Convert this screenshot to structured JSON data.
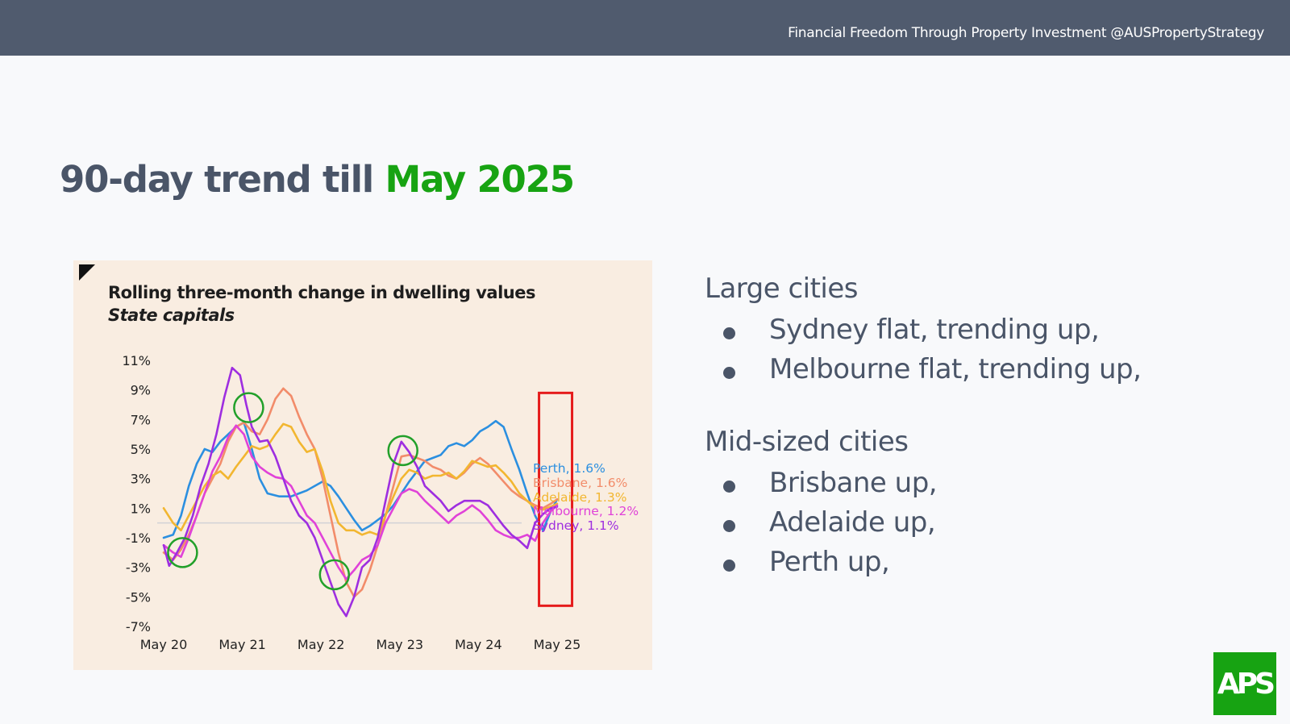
{
  "header": {
    "tagline": "Financial Freedom Through Property Investment @AUSPropertyStrategy"
  },
  "slide": {
    "title_prefix": "90-day trend till ",
    "title_accent": "May 2025"
  },
  "chart_data": {
    "type": "line",
    "title": "Rolling three-month change in dwelling values",
    "subtitle": "State capitals",
    "ylim": [
      -7,
      11
    ],
    "yticks": [
      11,
      9,
      7,
      5,
      3,
      1,
      -1,
      -3,
      -5,
      -7
    ],
    "ytick_labels": [
      "11%",
      "9%",
      "7%",
      "5%",
      "3%",
      "1%",
      "-1%",
      "-3%",
      "-5%",
      "-7%"
    ],
    "xlim": [
      2020.33,
      2025.42
    ],
    "xticks": [
      2020.33,
      2021.33,
      2022.33,
      2023.33,
      2024.33,
      2025.33
    ],
    "xtick_labels": [
      "May 20",
      "May 21",
      "May 22",
      "May 23",
      "May 24",
      "May 25"
    ],
    "grid": false,
    "zero_line": true,
    "series": [
      {
        "name": "Perth",
        "label": "Perth, 1.6%",
        "color": "#2b8fe0",
        "x": [
          2020.33,
          2020.45,
          2020.55,
          2020.65,
          2020.75,
          2020.85,
          2020.95,
          2021.05,
          2021.15,
          2021.25,
          2021.35,
          2021.45,
          2021.55,
          2021.65,
          2021.8,
          2021.95,
          2022.05,
          2022.15,
          2022.25,
          2022.35,
          2022.45,
          2022.55,
          2022.65,
          2022.75,
          2022.85,
          2022.95,
          2023.05,
          2023.15,
          2023.25,
          2023.35,
          2023.45,
          2023.55,
          2023.65,
          2023.75,
          2023.85,
          2023.95,
          2024.05,
          2024.15,
          2024.25,
          2024.35,
          2024.45,
          2024.55,
          2024.65,
          2024.75,
          2024.85,
          2024.95,
          2025.05,
          2025.15,
          2025.25,
          2025.33
        ],
        "y": [
          -1.0,
          -0.8,
          0.5,
          2.5,
          4.0,
          5.0,
          4.8,
          5.5,
          6.0,
          6.5,
          6.8,
          5.0,
          3.0,
          2.0,
          1.8,
          1.8,
          2.0,
          2.2,
          2.5,
          2.8,
          2.5,
          1.8,
          1.0,
          0.2,
          -0.5,
          -0.2,
          0.2,
          0.6,
          1.2,
          2.0,
          2.8,
          3.5,
          4.2,
          4.4,
          4.6,
          5.2,
          5.4,
          5.2,
          5.6,
          6.2,
          6.5,
          6.9,
          6.5,
          5.0,
          3.6,
          2.0,
          0.5,
          -0.5,
          0.8,
          1.6
        ]
      },
      {
        "name": "Brisbane",
        "label": "Brisbane, 1.6%",
        "color": "#f28c6a",
        "x": [
          2020.33,
          2020.45,
          2020.55,
          2020.65,
          2020.75,
          2020.85,
          2020.95,
          2021.05,
          2021.15,
          2021.25,
          2021.35,
          2021.45,
          2021.55,
          2021.65,
          2021.75,
          2021.85,
          2021.95,
          2022.05,
          2022.15,
          2022.25,
          2022.35,
          2022.45,
          2022.55,
          2022.65,
          2022.75,
          2022.85,
          2022.95,
          2023.05,
          2023.15,
          2023.25,
          2023.35,
          2023.45,
          2023.55,
          2023.65,
          2023.75,
          2023.85,
          2023.95,
          2024.05,
          2024.15,
          2024.25,
          2024.35,
          2024.45,
          2024.55,
          2024.65,
          2024.75,
          2024.85,
          2024.95,
          2025.05,
          2025.15,
          2025.25,
          2025.33
        ],
        "y": [
          -2.0,
          -2.5,
          -1.8,
          -0.8,
          0.5,
          2.0,
          3.0,
          4.0,
          5.5,
          6.5,
          6.8,
          6.2,
          6.0,
          7.0,
          8.4,
          9.1,
          8.6,
          7.2,
          6.0,
          5.0,
          3.0,
          0.5,
          -2.0,
          -4.0,
          -5.0,
          -4.5,
          -3.2,
          -1.5,
          0.5,
          2.5,
          4.5,
          4.6,
          4.4,
          4.2,
          3.8,
          3.6,
          3.2,
          3.0,
          3.4,
          4.0,
          4.4,
          4.0,
          3.4,
          2.8,
          2.2,
          1.8,
          1.5,
          1.2,
          1.0,
          1.3,
          1.6
        ]
      },
      {
        "name": "Adelaide",
        "label": "Adelaide, 1.3%",
        "color": "#f2b630",
        "x": [
          2020.33,
          2020.45,
          2020.55,
          2020.65,
          2020.75,
          2020.85,
          2020.95,
          2021.05,
          2021.15,
          2021.25,
          2021.35,
          2021.45,
          2021.55,
          2021.65,
          2021.75,
          2021.85,
          2021.95,
          2022.05,
          2022.15,
          2022.25,
          2022.35,
          2022.45,
          2022.55,
          2022.65,
          2022.75,
          2022.85,
          2022.95,
          2023.05,
          2023.15,
          2023.25,
          2023.35,
          2023.45,
          2023.55,
          2023.65,
          2023.75,
          2023.85,
          2023.95,
          2024.05,
          2024.15,
          2024.25,
          2024.35,
          2024.45,
          2024.55,
          2024.65,
          2024.75,
          2024.85,
          2024.95,
          2025.05,
          2025.15,
          2025.25,
          2025.33
        ],
        "y": [
          1.0,
          0.0,
          -0.5,
          0.5,
          1.5,
          2.5,
          3.2,
          3.5,
          3.0,
          3.8,
          4.5,
          5.2,
          5.0,
          5.2,
          6.0,
          6.7,
          6.5,
          5.5,
          4.8,
          5.0,
          3.5,
          1.5,
          0.0,
          -0.5,
          -0.5,
          -0.8,
          -0.6,
          -0.8,
          0.5,
          1.8,
          3.0,
          3.6,
          3.4,
          3.0,
          3.2,
          3.2,
          3.4,
          3.0,
          3.5,
          4.2,
          4.0,
          3.8,
          3.9,
          3.4,
          2.8,
          2.0,
          1.5,
          1.0,
          0.9,
          1.1,
          1.3
        ]
      },
      {
        "name": "Melbourne",
        "label": "Melbourne, 1.2%",
        "color": "#e042d8",
        "x": [
          2020.33,
          2020.45,
          2020.55,
          2020.65,
          2020.75,
          2020.85,
          2020.95,
          2021.05,
          2021.15,
          2021.25,
          2021.35,
          2021.45,
          2021.55,
          2021.65,
          2021.75,
          2021.85,
          2021.95,
          2022.05,
          2022.15,
          2022.25,
          2022.35,
          2022.45,
          2022.55,
          2022.65,
          2022.75,
          2022.85,
          2022.95,
          2023.05,
          2023.15,
          2023.25,
          2023.35,
          2023.45,
          2023.55,
          2023.65,
          2023.75,
          2023.85,
          2023.95,
          2024.05,
          2024.15,
          2024.25,
          2024.35,
          2024.45,
          2024.55,
          2024.65,
          2024.75,
          2024.85,
          2024.95,
          2025.05,
          2025.15,
          2025.25,
          2025.33
        ],
        "y": [
          -1.5,
          -2.0,
          -2.3,
          -1.0,
          0.5,
          2.0,
          3.5,
          4.5,
          5.8,
          6.6,
          6.0,
          4.5,
          3.8,
          3.4,
          3.1,
          3.0,
          2.5,
          1.5,
          0.5,
          0.0,
          -1.0,
          -2.0,
          -3.0,
          -3.8,
          -3.2,
          -2.5,
          -2.2,
          -1.5,
          0.0,
          1.0,
          2.0,
          2.3,
          2.1,
          1.5,
          1.0,
          0.5,
          0.0,
          0.5,
          0.8,
          1.2,
          0.8,
          0.2,
          -0.5,
          -0.8,
          -1.0,
          -1.0,
          -0.8,
          -1.2,
          0.0,
          0.8,
          1.2
        ]
      },
      {
        "name": "Sydney",
        "label": "Sydney, 1.1%",
        "color": "#9e2ee0",
        "x": [
          2020.33,
          2020.4,
          2020.5,
          2020.6,
          2020.7,
          2020.8,
          2020.9,
          2021.0,
          2021.1,
          2021.2,
          2021.3,
          2021.38,
          2021.45,
          2021.55,
          2021.65,
          2021.75,
          2021.85,
          2021.95,
          2022.05,
          2022.15,
          2022.25,
          2022.35,
          2022.45,
          2022.55,
          2022.65,
          2022.75,
          2022.85,
          2022.95,
          2023.05,
          2023.15,
          2023.25,
          2023.35,
          2023.45,
          2023.55,
          2023.65,
          2023.75,
          2023.85,
          2023.95,
          2024.05,
          2024.15,
          2024.25,
          2024.35,
          2024.45,
          2024.55,
          2024.65,
          2024.75,
          2024.85,
          2024.95,
          2025.05,
          2025.15,
          2025.25,
          2025.33
        ],
        "y": [
          -1.5,
          -2.9,
          -2.0,
          -1.0,
          0.5,
          2.5,
          4.0,
          6.0,
          8.5,
          10.5,
          10.0,
          8.0,
          6.5,
          5.5,
          5.6,
          4.5,
          3.0,
          1.5,
          0.5,
          0.0,
          -1.0,
          -2.5,
          -4.0,
          -5.5,
          -6.3,
          -5.0,
          -3.0,
          -2.5,
          -1.0,
          1.5,
          4.0,
          5.5,
          4.8,
          3.8,
          2.5,
          2.0,
          1.5,
          0.8,
          1.2,
          1.5,
          1.5,
          1.5,
          1.2,
          0.5,
          -0.2,
          -0.8,
          -1.2,
          -1.7,
          0.0,
          0.6,
          1.0,
          1.1
        ]
      }
    ],
    "annotations": [
      {
        "shape": "circle",
        "x": 2020.57,
        "y": -2.0,
        "color": "#22a02a"
      },
      {
        "shape": "circle",
        "x": 2021.41,
        "y": 7.8,
        "color": "#22a02a"
      },
      {
        "shape": "circle",
        "x": 2022.5,
        "y": -3.5,
        "color": "#22a02a"
      },
      {
        "shape": "circle",
        "x": 2023.37,
        "y": 4.9,
        "color": "#22a02a"
      },
      {
        "shape": "rect",
        "x0": 2025.1,
        "x1": 2025.52,
        "y0": -5.6,
        "y1": 8.8,
        "color": "#e51b1b"
      }
    ]
  },
  "panel": {
    "large_heading": "Large cities",
    "large_items": [
      "Sydney flat, trending up,",
      "Melbourne flat, trending up,"
    ],
    "mid_heading": "Mid-sized cities",
    "mid_items": [
      "Brisbane up,",
      "Adelaide up,",
      "Perth up,"
    ]
  },
  "logo": {
    "text": "APS"
  },
  "colors": {
    "topbar": "#505b6e",
    "accent": "#17a312",
    "text": "#4a5568",
    "card_bg": "#f9ede1"
  }
}
